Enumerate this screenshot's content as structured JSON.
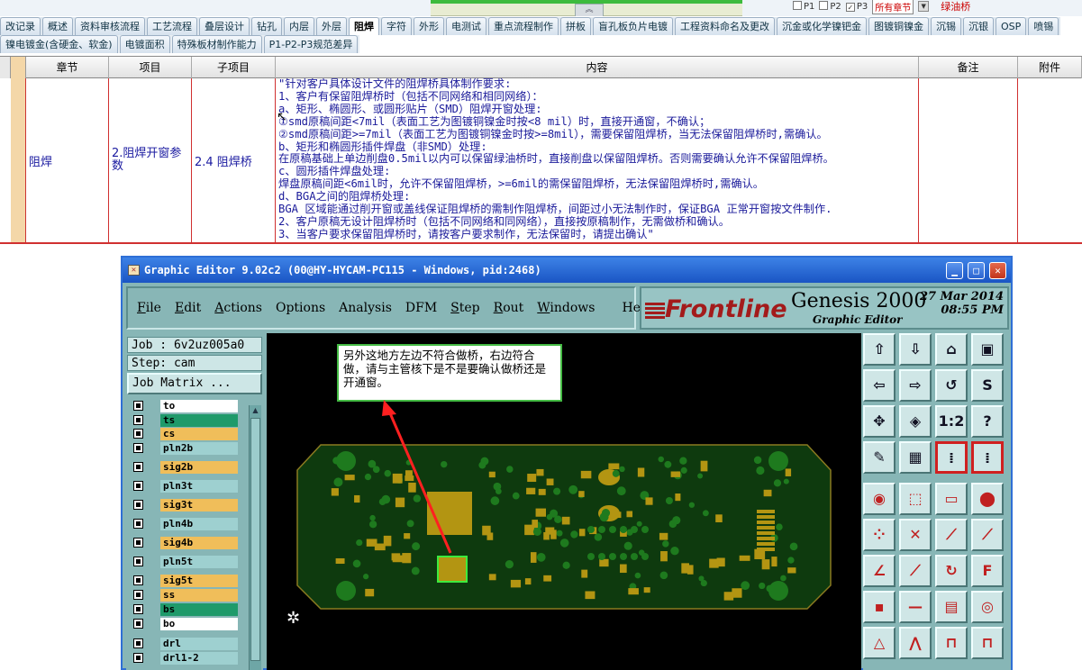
{
  "topbar": {
    "filters": [
      {
        "label": "P1",
        "checked": false
      },
      {
        "label": "P2",
        "checked": false
      },
      {
        "label": "P3",
        "checked": true
      }
    ],
    "chapter_select": "所有章节",
    "extra": "绿油桥"
  },
  "tabs_row1": [
    "改记录",
    "概述",
    "资料审核流程",
    "工艺流程",
    "叠层设计",
    "钻孔",
    "内层",
    "外层",
    "阻焊",
    "字符",
    "外形",
    "电测试",
    "重点流程制作",
    "拼板",
    "盲孔板负片电镀",
    "工程资料命名及更改",
    "沉金或化学镍钯金",
    "图镀铜镍金",
    "沉锡",
    "沉银",
    "OSP",
    "喷锡"
  ],
  "active_tab": "阻焊",
  "tabs_row2": [
    "镍电镀金(含硬金、软金)",
    "电镀面积",
    "特殊板材制作能力",
    "P1-P2-P3规范差异"
  ],
  "grid": {
    "headers": [
      "章节",
      "项目",
      "子项目",
      "内容",
      "备注",
      "附件"
    ],
    "row": {
      "chapter": "阻焊",
      "item": "2.阻焊开窗参数",
      "subitem": "2.4 阻焊桥",
      "content": [
        "\"针对客户具体设计文件的阻焊桥具体制作要求:",
        "1、客户有保留阻焊桥时（包括不同网络和相同网络）：",
        "a、矩形、椭圆形、或圆形贴片（SMD）阻焊开窗处理:",
        "①smd原稿间距<7mil（表面工艺为图镀铜镍金时按<8 mil）时，直接开通窗，不确认；",
        "②smd原稿间距>=7mil（表面工艺为图镀铜镍金时按>=8mil），需要保留阻焊桥，当无法保留阻焊桥时,需确认。",
        "b、矩形和椭圆形插件焊盘（非SMD）处理:",
        "在原稿基础上单边削盘0.5mil以内可以保留绿油桥时，直接削盘以保留阻焊桥。否则需要确认允许不保留阻焊桥。",
        "c、圆形插件焊盘处理:",
        "焊盘原稿间距<6mil时，允许不保留阻焊桥，>=6mil的需保留阻焊桥，无法保留阻焊桥时,需确认。",
        "d、BGA之间的阻焊桥处理:",
        "BGA 区域能通过削开窗或盖线保证阻焊桥的需制作阻焊桥，间距过小无法制作时，保证BGA 正常开窗按文件制作.",
        "2、客户原稿无设计阻焊桥时（包括不同网络和同网络），直接按原稿制作，无需做桥和确认。",
        "3、当客户要求保留阻焊桥时，请按客户要求制作，无法保留时，请提出确认\""
      ]
    }
  },
  "graphic_editor": {
    "title": "Graphic Editor 9.02c2 (00@HY-HYCAM-PC115 - Windows, pid:2468)",
    "menu": [
      "File",
      "Edit",
      "Actions",
      "Options",
      "Analysis",
      "DFM",
      "Step",
      "Rout",
      "Windows",
      "Help"
    ],
    "brand": "Frontline",
    "product": "Genesis 2000",
    "subtitle": "Graphic Editor",
    "date": "27 Mar 2014",
    "time": "08:55 PM",
    "job": "Job : 6v2uz005a0",
    "step": "Step: cam",
    "job_matrix": "Job Matrix ...",
    "layers": [
      {
        "name": "to",
        "color": "#ffffff"
      },
      {
        "name": "ts",
        "color": "#1f9a6a"
      },
      {
        "name": "cs",
        "color": "#f0be5a"
      },
      {
        "name": "pln2b",
        "color": "#9ed0d0"
      },
      {
        "name": "sig2b",
        "color": "#f0be5a"
      },
      {
        "name": "pln3t",
        "color": "#9ed0d0"
      },
      {
        "name": "sig3t",
        "color": "#f0be5a"
      },
      {
        "name": "pln4b",
        "color": "#9ed0d0"
      },
      {
        "name": "sig4b",
        "color": "#f0be5a"
      },
      {
        "name": "pln5t",
        "color": "#9ed0d0"
      },
      {
        "name": "sig5t",
        "color": "#f0be5a"
      },
      {
        "name": "ss",
        "color": "#f0be5a"
      },
      {
        "name": "bs",
        "color": "#1f9a6a"
      },
      {
        "name": "bo",
        "color": "#ffffff"
      },
      {
        "name": "drl",
        "color": "#9ed0d0"
      },
      {
        "name": "drl1-2",
        "color": "#9ed0d0"
      }
    ],
    "annotation": "另外这地方左边不符合做桥，右边符合做，请与主管核下是不是要确认做桥还是开通窗。"
  },
  "colors": {
    "pcb_board": "#0e3a0e",
    "pad": "#b39512",
    "solder": "#1e7a1e",
    "accent_red": "#d02020"
  }
}
